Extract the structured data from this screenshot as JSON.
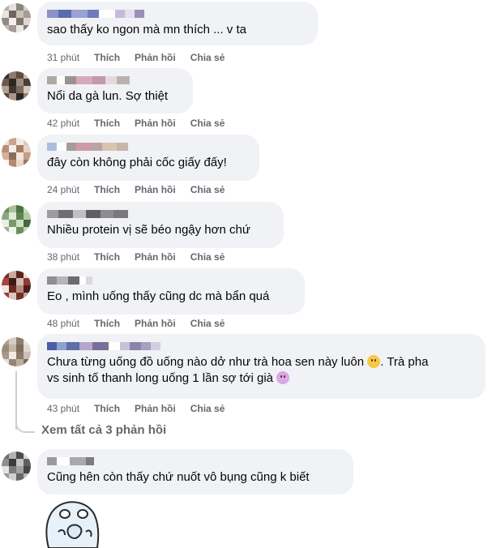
{
  "labels": {
    "like": "Thích",
    "reply": "Phản hồi",
    "share": "Chia sẻ"
  },
  "comments": [
    {
      "author": "Nguyễn",
      "text": "sao thấy ko ngon mà mn thích ... v ta",
      "time": "31 phút"
    },
    {
      "author": "",
      "text": "Nổi da gà lun. Sợ thiệt",
      "time": "42 phút"
    },
    {
      "author": "",
      "text": "đây còn không phải cốc giấy đấy!",
      "time": "24 phút"
    },
    {
      "author": "",
      "text": "Nhiều protein vị sẽ béo ngậy hơn chứ",
      "time": "38 phút"
    },
    {
      "author": "",
      "text": "Eo , mình uống thấy cũng dc mà bẩn quá",
      "time": "48 phút"
    },
    {
      "author": "",
      "text_line1": "Chưa từng uống đồ uống nào dở như trà hoa sen này luôn",
      "text_line1_after": ". Trà pha",
      "text_line2": "vs sinh tố thanh long uống 1 lần sợ tới già",
      "time": "43 phút",
      "emoji1": "worried-face",
      "emoji2": "sick-face"
    },
    {
      "author": "",
      "text": "Cũng hên còn thấy chứ nuốt vô bụng cũng k biết"
    }
  ],
  "view_replies": "Xem tất cả 3 phản hồi",
  "sticker": "bear-sticker"
}
